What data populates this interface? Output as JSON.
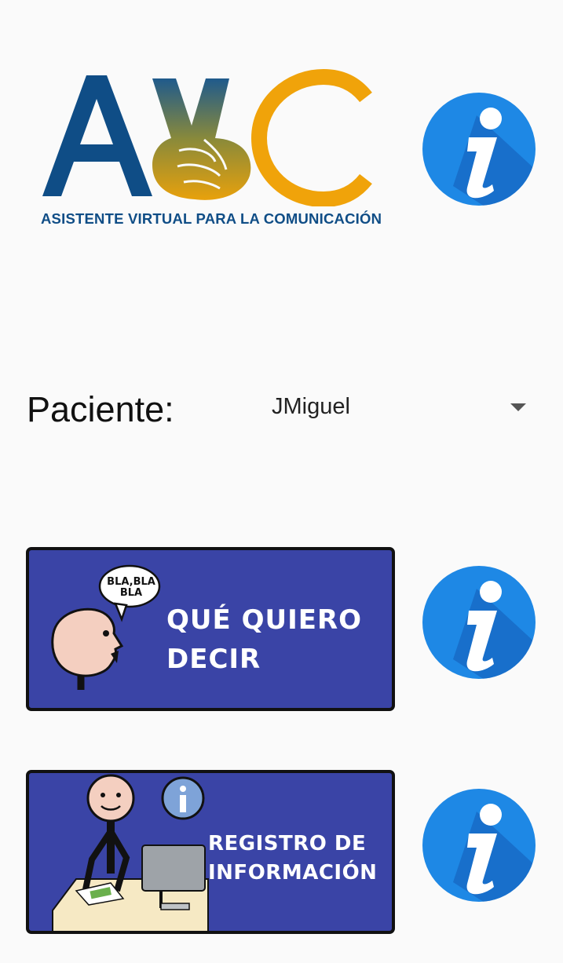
{
  "logo": {
    "letters": [
      "A",
      "C"
    ],
    "subtitle": "ASISTENTE VIRTUAL PARA LA COMUNICACIÓN",
    "colors": {
      "blue": "#0f4d86",
      "gold": "#f0a30a"
    }
  },
  "patient": {
    "label": "Paciente:",
    "selected": "JMiguel"
  },
  "cards": [
    {
      "title_lines": [
        "QUÉ QUIERO",
        "DECIR"
      ],
      "bubble_text": "BLA,BLA BLA"
    },
    {
      "title_lines": [
        "REGISTRO DE",
        "INFORMACIÓN"
      ]
    }
  ],
  "icons": {
    "info": "info-icon",
    "dropdown": "chevron-down-icon"
  },
  "colors": {
    "card_bg": "#3a44a6",
    "info_blue": "#1e88e5",
    "background": "#fafafa"
  }
}
